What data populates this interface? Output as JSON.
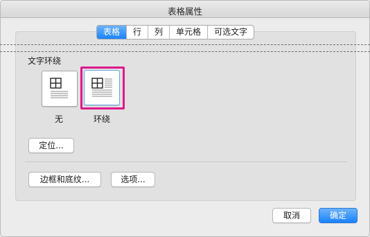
{
  "window": {
    "title": "表格属性"
  },
  "tabs": [
    {
      "label": "表格",
      "active": true
    },
    {
      "label": "行"
    },
    {
      "label": "列"
    },
    {
      "label": "单元格"
    },
    {
      "label": "可选文字"
    }
  ],
  "text_wrapping": {
    "heading": "文字环绕",
    "options": [
      {
        "label": "无",
        "icon": "wrap-none-icon",
        "selected": false
      },
      {
        "label": "环绕",
        "icon": "wrap-around-icon",
        "selected": true
      }
    ],
    "position_button": "定位..."
  },
  "bottom_buttons": {
    "borders_shading": "边框和底纹...",
    "options": "选项..."
  },
  "dialog_buttons": {
    "cancel": "取消",
    "ok": "确定"
  },
  "colors": {
    "accent": "#1a82fb",
    "selection_highlight": "#e0178c"
  }
}
